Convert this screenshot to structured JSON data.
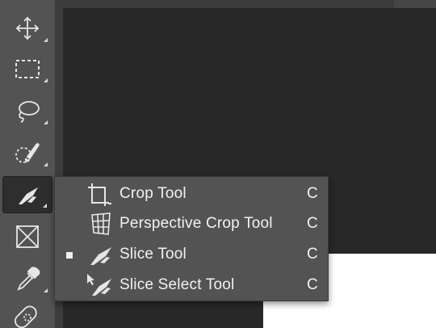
{
  "toolbar": {
    "tools": [
      {
        "name": "Move Tool",
        "icon": "move-icon"
      },
      {
        "name": "Rectangular Marquee Tool",
        "icon": "marquee-icon"
      },
      {
        "name": "Lasso Tool",
        "icon": "lasso-icon"
      },
      {
        "name": "Quick Selection Tool",
        "icon": "quick-selection-icon"
      },
      {
        "name": "Slice Tool",
        "icon": "slice-icon",
        "active": true
      },
      {
        "name": "Frame Tool",
        "icon": "frame-icon"
      },
      {
        "name": "Eyedropper Tool",
        "icon": "eyedropper-icon"
      },
      {
        "name": "Spot Healing Brush Tool",
        "icon": "bandage-icon"
      }
    ]
  },
  "flyout": {
    "items": [
      {
        "label": "Crop Tool",
        "shortcut": "C",
        "icon": "crop-icon",
        "selected": false
      },
      {
        "label": "Perspective Crop Tool",
        "shortcut": "C",
        "icon": "perspective-crop-icon",
        "selected": false
      },
      {
        "label": "Slice Tool",
        "shortcut": "C",
        "icon": "slice-icon",
        "selected": true
      },
      {
        "label": "Slice Select Tool",
        "shortcut": "C",
        "icon": "slice-select-icon",
        "selected": false
      }
    ]
  },
  "colors": {
    "toolbar_bg": "#535353",
    "canvas_bg": "#282828",
    "menu_bg": "#535353",
    "icon": "#e6e6e6"
  }
}
